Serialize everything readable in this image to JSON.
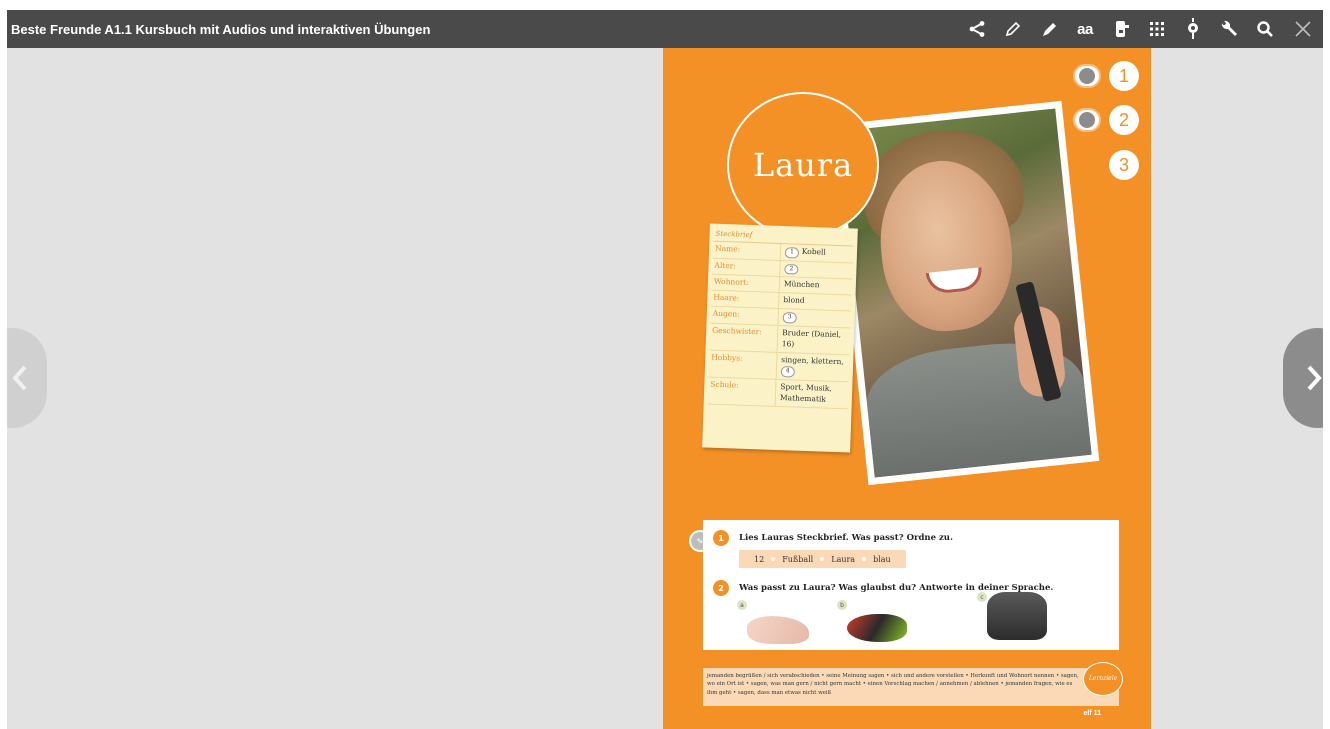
{
  "app": {
    "title": "Beste Freunde A1.1 Kursbuch mit Audios und interaktiven Übungen"
  },
  "toolbar": {
    "font_toggle_label": "aa",
    "icons": [
      "share-icon",
      "pencil-icon",
      "marker-icon",
      "font-size-icon",
      "stamp-icon",
      "grid-icon",
      "pin-icon",
      "wrench-icon",
      "search-icon",
      "close-icon"
    ]
  },
  "page": {
    "name_heading": "Laura",
    "audio_numbers": [
      "1",
      "2",
      "3"
    ],
    "profile": {
      "heading": "Steckbrief",
      "rows": [
        {
          "key": "Name:",
          "value": "Kobell",
          "pill": "1"
        },
        {
          "key": "Alter:",
          "value": "",
          "pill": "2"
        },
        {
          "key": "Wohnort:",
          "value": "München",
          "pill": ""
        },
        {
          "key": "Haare:",
          "value": "blond",
          "pill": ""
        },
        {
          "key": "Augen:",
          "value": "",
          "pill": "3"
        },
        {
          "key": "Geschwister:",
          "value": "Bruder (Daniel, 16)",
          "pill": ""
        },
        {
          "key": "Hobbys:",
          "value": "singen, klettern,",
          "pill": "4"
        },
        {
          "key": "Schule:",
          "value": "Sport, Musik, Mathematik",
          "pill": ""
        }
      ]
    },
    "task1": {
      "number": "1",
      "text": "Lies Lauras Steckbrief. Was passt? Ordne zu.",
      "words": [
        "12",
        "Fußball",
        "Laura",
        "blau"
      ]
    },
    "task2": {
      "number": "2",
      "text": "Was passt zu Laura? Was glaubst du? Antworte in deiner Sprache.",
      "labels": [
        "a",
        "b",
        "c"
      ]
    },
    "goals": {
      "text": "jemanden begrüßen / sich verabschieden • seine Meinung sagen • sich und andere vorstellen • Herkunft und Wohnort nennen • sagen, wo ein Ort ist • sagen, was man gern / nicht gern macht • einen Vorschlag machen / annehmen / ablehnen • jemanden fragen, wie es ihm geht • sagen, dass man etwas nicht weiß",
      "badge": "Lernziele"
    },
    "page_number": "elf 11"
  },
  "colors": {
    "page_orange": "#f39126",
    "toolbar": "#4a4a4a",
    "background": "#e2e2e2"
  }
}
